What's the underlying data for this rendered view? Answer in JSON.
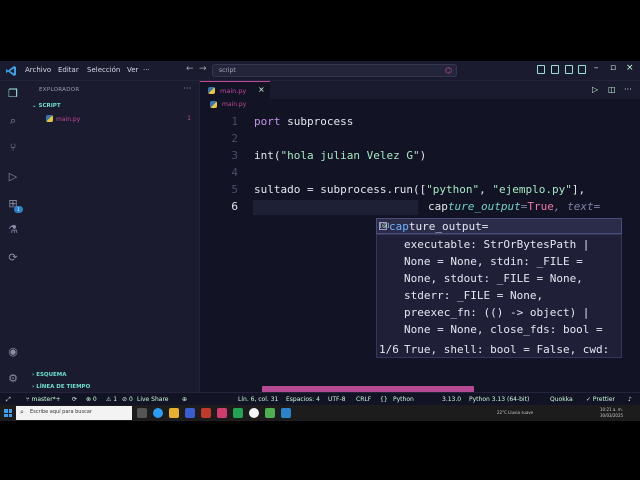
{
  "titlebar": {
    "menu": [
      "Archivo",
      "Editar",
      "Selección",
      "Ver"
    ],
    "more": "···",
    "search": "script",
    "back": "←",
    "forward": "→"
  },
  "sidebar": {
    "title": "EXPLORADOR",
    "more": "···",
    "folder": "SCRIPT",
    "file": "main.py",
    "file_problems": "1",
    "outline": "ESQUEMA",
    "timeline": "LÍNEA DE TIEMPO"
  },
  "activity": {
    "extensions_badge": "1",
    "remote_badge": "1"
  },
  "tabs": [
    {
      "label": "main.py",
      "close": "×"
    }
  ],
  "breadcrumb": "main.py",
  "editor": {
    "line_numbers": [
      "1",
      "2",
      "3",
      "4",
      "5",
      "6"
    ],
    "lines": {
      "l1_kw": "port",
      "l1_rest": " subprocess",
      "l3_fn": "int(",
      "l3_str": "\"hola julian Velez G\"",
      "l3_end": ")",
      "l5_a": "sultado = subprocess.run([",
      "l5_s1": "\"python\"",
      "l5_sep": ", ",
      "l5_s2": "\"ejemplo.py\"",
      "l5_end": "],",
      "l6_cap": "cap",
      "l6_param": "ture_output",
      "l6_eq": "=",
      "l6_val": "True",
      "l6_hint": ", text="
    }
  },
  "suggest": {
    "icon": "[@]",
    "match": "cap",
    "rest": "ture_output="
  },
  "signature": {
    "lines": [
      "executable: StrOrBytesPath |",
      "None = None, stdin: _FILE =",
      "None, stdout: _FILE = None,",
      "stderr: _FILE = None,",
      "preexec_fn: (() -> object) |",
      "None = None, close_fds: bool =",
      "True, shell: bool = False, cwd:"
    ],
    "count": "1/6"
  },
  "statusbar": {
    "branch": "master*+",
    "errors": "⊗ 0",
    "warnings": "⚠ 1",
    "ports": "0",
    "live_share": "Live Share",
    "position": "Lín. 6, col. 31",
    "spaces": "Espacios: 4",
    "encoding": "UTF-8",
    "eol": "CRLF",
    "language": "Python",
    "version": "3.13.0",
    "interpreter": "Python 3.13 (64-bit)",
    "quokka": "Quokka",
    "prettier": "✓ Prettier"
  },
  "taskbar": {
    "search_placeholder": "Escribe aquí para buscar",
    "weather": "22°C  Lluvia suave",
    "time": "10:21 a. m.",
    "date": "30/03/2025"
  },
  "colors": {
    "accent": "#c04a9a",
    "teal": "#6ce0d2",
    "editor_bg": "#121324",
    "panel_bg": "#1a1b2e"
  }
}
